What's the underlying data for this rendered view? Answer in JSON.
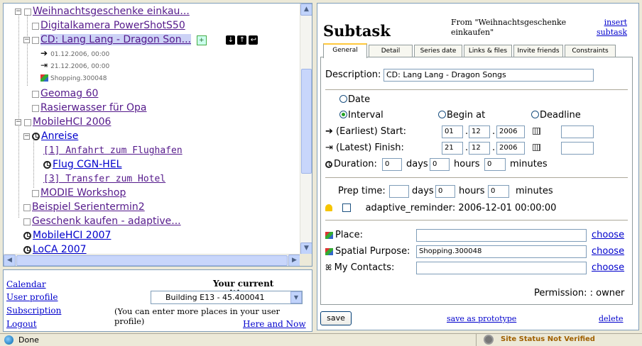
{
  "tree": {
    "items": [
      {
        "label": "Weihnachtsgeschenke einkau..."
      },
      {
        "label": "Digitalkamera PowerShotS50"
      },
      {
        "label": "CD: Lang Lang - Dragon Son..."
      },
      {
        "label": "01.12.2006, 00:00"
      },
      {
        "label": "21.12.2006, 00:00"
      },
      {
        "label": "Shopping.300048"
      },
      {
        "label": "Geomag 60"
      },
      {
        "label": "Rasierwasser für Opa"
      },
      {
        "label": "MobileHCI 2006"
      },
      {
        "label": "Anreise"
      },
      {
        "label": "[1] Anfahrt zum Flughafen"
      },
      {
        "label": "Flug CGN-HEL"
      },
      {
        "label": "[3] Transfer zum Hotel"
      },
      {
        "label": "MODIE Workshop"
      },
      {
        "label": "Beispiel Serientermin2"
      },
      {
        "label": "Geschenk kaufen - adaptive..."
      },
      {
        "label": "MobileHCI 2007"
      },
      {
        "label": "LoCA 2007"
      }
    ]
  },
  "position": {
    "heading": "Your current position",
    "selected": "Building E13 - 45.400041",
    "hint": "(You can enter more places in your user profile)",
    "here_now": "Here and Now",
    "links": [
      "Calendar",
      "User profile",
      "Subscription",
      "Logout"
    ]
  },
  "subtask": {
    "title": "Subtask",
    "from": "From \"Weihnachtsgeschenke einkaufen\"",
    "insert_link": "insert subtask",
    "tabs": [
      "General",
      "Detail",
      "Series date",
      "Links & files",
      "Invite friends",
      "Constraints"
    ],
    "description_label": "Description:",
    "description_value": "CD: Lang Lang - Dragon Songs",
    "date_label": "Date",
    "interval_label": "Interval",
    "begin_label": "Begin at",
    "deadline_label": "Deadline",
    "start_label": "(Earliest) Start:",
    "start_day": "01",
    "start_month": "12",
    "start_year": "2006",
    "finish_label": "(Latest) Finish:",
    "finish_day": "21",
    "finish_month": "12",
    "finish_year": "2006",
    "duration_label": "Duration:",
    "duration_days": "0",
    "days_label": "days",
    "duration_hours": "0",
    "hours_label": "hours",
    "duration_minutes": "0",
    "minutes_label": "minutes",
    "prep_label": "Prep time:",
    "prep_days": "0",
    "prep_hours": "0",
    "reminder_text": "adaptive_reminder: 2006-12-01 00:00:00",
    "place_label": "Place:",
    "spatial_label": "Spatial Purpose:",
    "spatial_value": "Shopping.300048",
    "contacts_label": "My Contacts:",
    "choose": "choose",
    "permission": "Permission: : owner",
    "save": "save",
    "save_prototype": "save as prototype",
    "delete": "delete",
    "dot": "."
  },
  "status": {
    "left": "Done",
    "site_status": "Site Status Not Verified"
  }
}
